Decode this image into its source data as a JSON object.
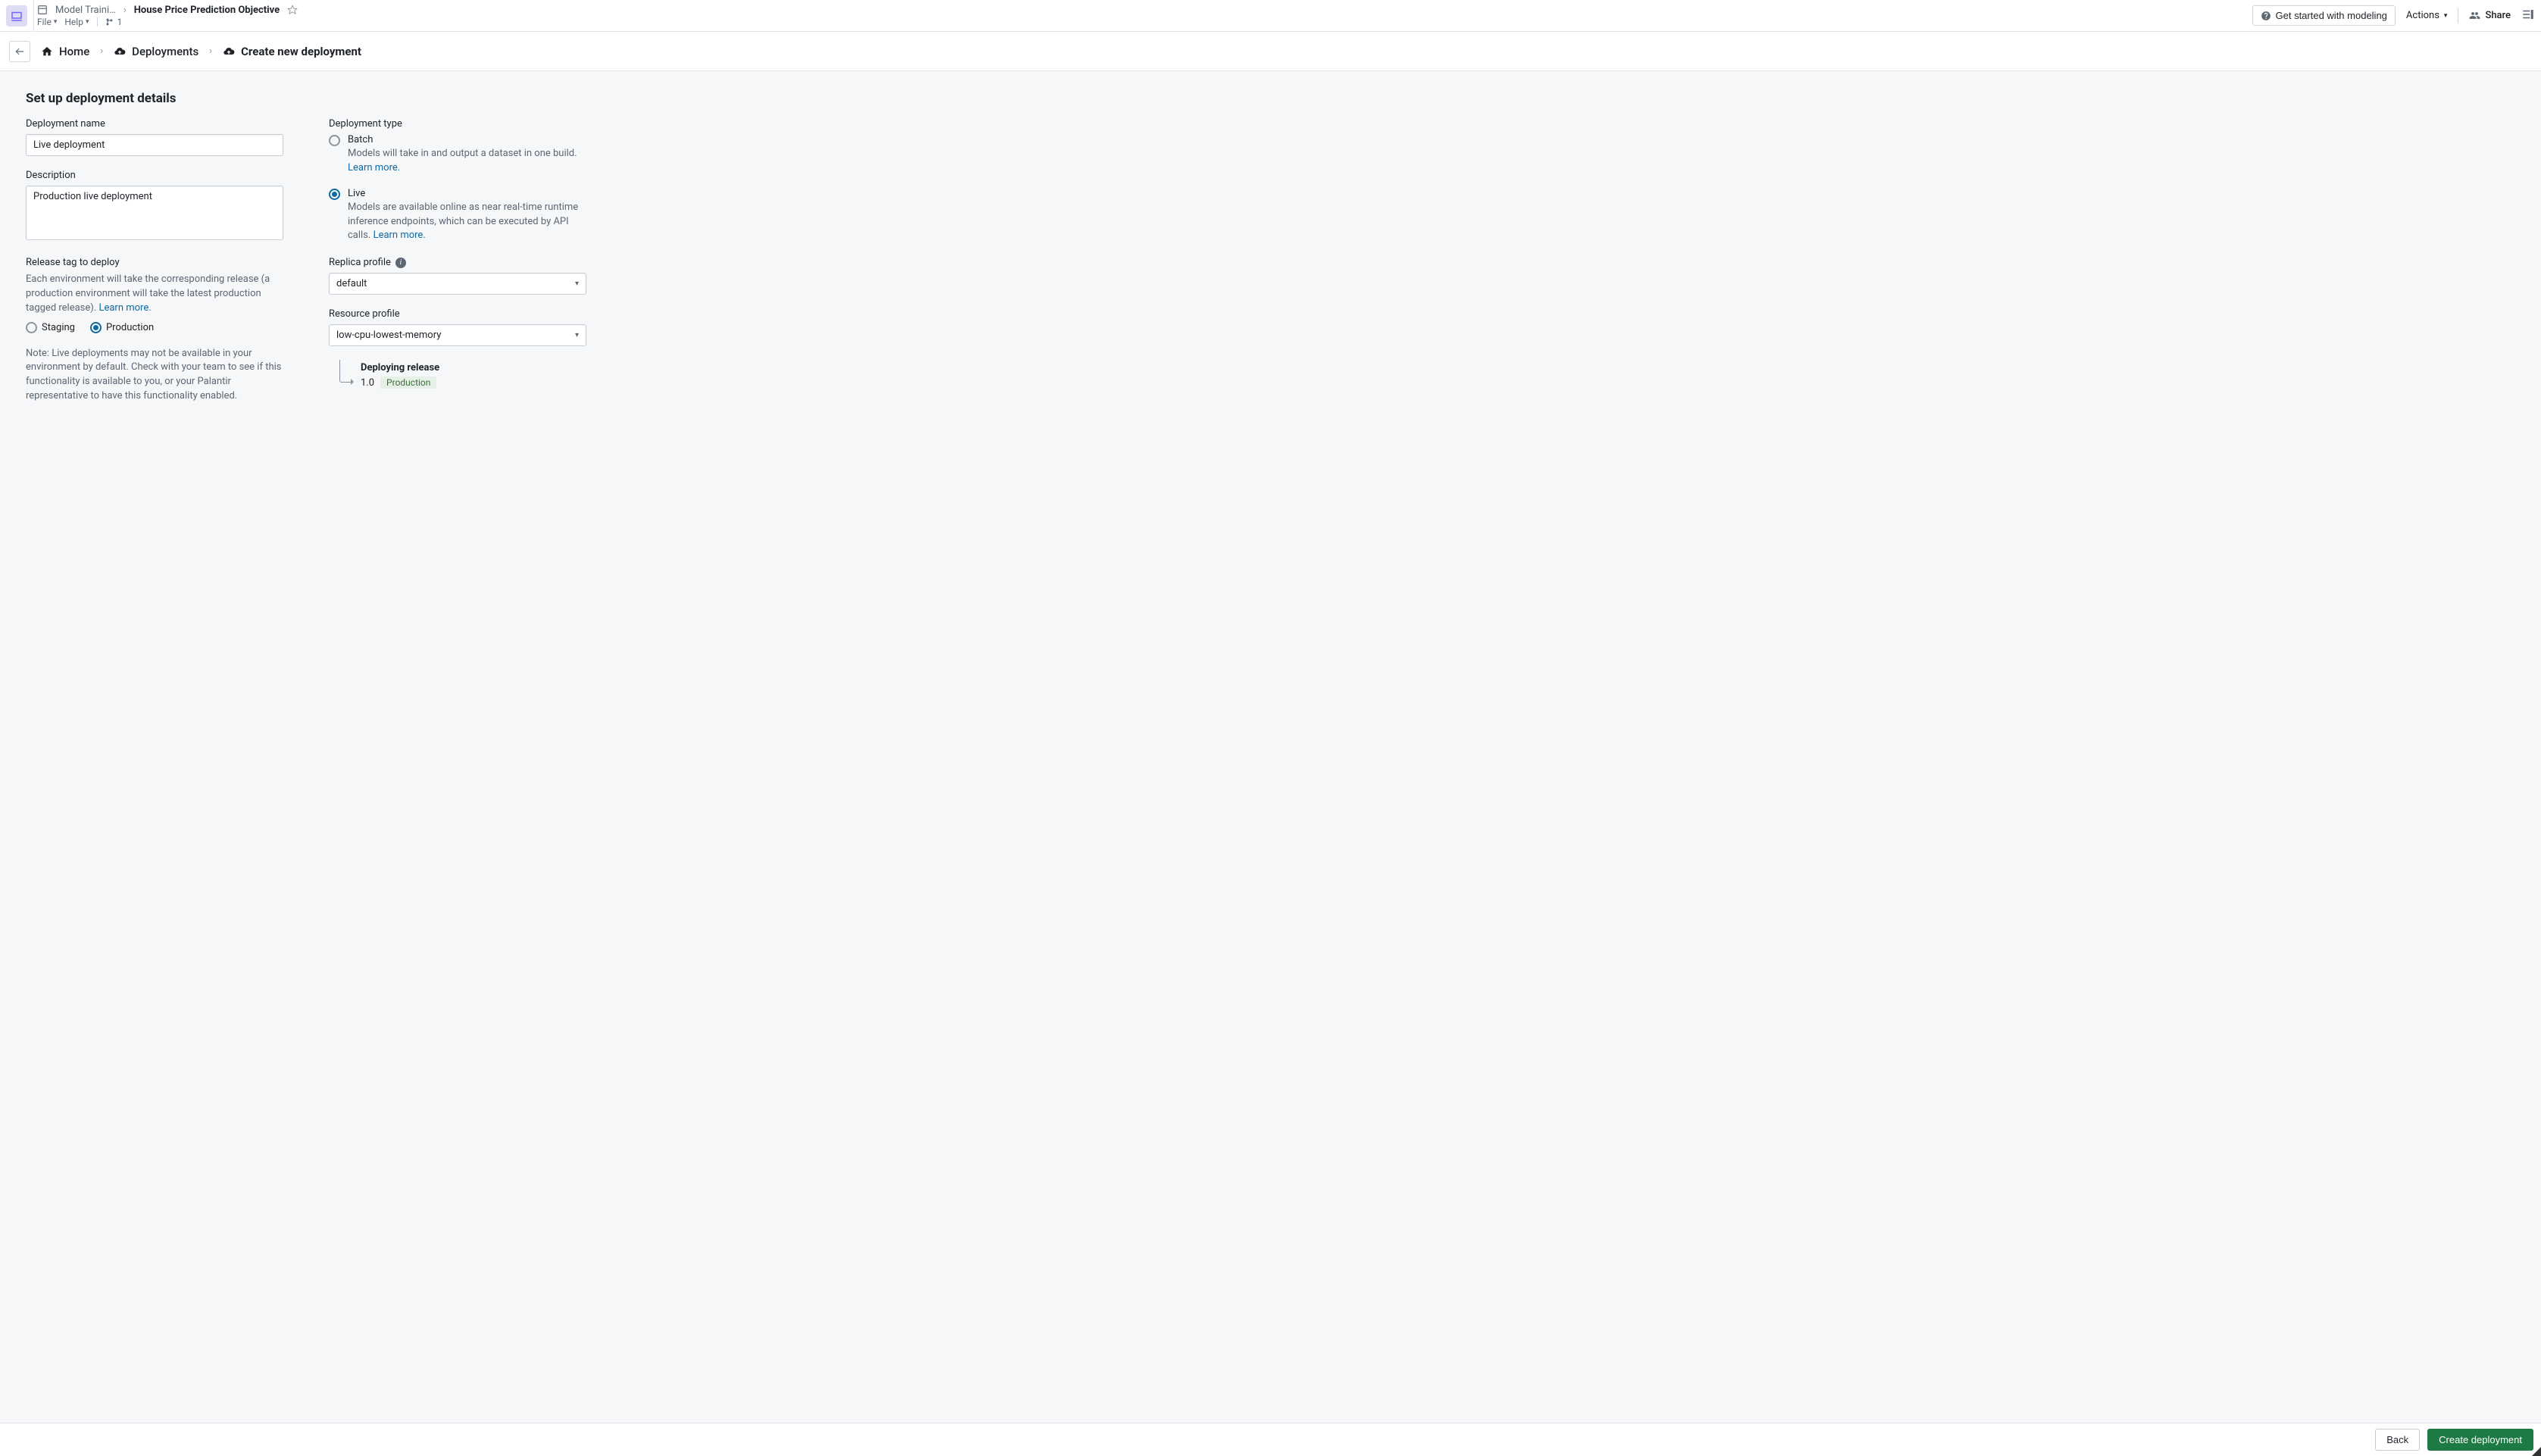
{
  "header": {
    "project_name": "Model Traini…",
    "page_title": "House Price Prediction Objective",
    "file_menu": "File",
    "help_menu": "Help",
    "branch_count": "1",
    "get_started": "Get started with modeling",
    "actions": "Actions",
    "share": "Share"
  },
  "breadcrumb": {
    "home": "Home",
    "deployments": "Deployments",
    "create": "Create new deployment"
  },
  "form": {
    "section_title": "Set up deployment details",
    "name_label": "Deployment name",
    "name_value": "Live deployment",
    "desc_label": "Description",
    "desc_value": "Production live deployment",
    "release_tag_label": "Release tag to deploy",
    "release_tag_help": "Each environment will take the corresponding release (a production environment will take the latest production tagged release). ",
    "learn_more": "Learn more.",
    "staging": "Staging",
    "production": "Production",
    "note_text": "Note: Live deployments may not be available in your environment by default. Check with your team to see if this functionality is available to you, or your Palantir representative to have this functionality enabled.",
    "type_label": "Deployment type",
    "batch_title": "Batch",
    "batch_desc": "Models will take in and output a dataset in one build. ",
    "live_title": "Live",
    "live_desc": "Models are available online as near real-time runtime inference endpoints, which can be executed by API calls. ",
    "replica_label": "Replica profile",
    "replica_value": "default",
    "resource_label": "Resource profile",
    "resource_value": "low-cpu-lowest-memory",
    "deploying_release": "Deploying release",
    "release_version": "1.0",
    "release_tag_badge": "Production"
  },
  "footer": {
    "back": "Back",
    "create": "Create deployment"
  }
}
